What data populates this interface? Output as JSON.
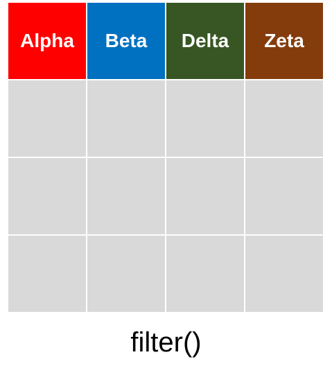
{
  "table": {
    "headers": [
      {
        "label": "Alpha",
        "color": "#ff0000"
      },
      {
        "label": "Beta",
        "color": "#0070c0"
      },
      {
        "label": "Delta",
        "color": "#375623"
      },
      {
        "label": "Zeta",
        "color": "#843c0c"
      }
    ],
    "empty_rows": 3,
    "cell_color": "#d9d9d9"
  },
  "caption": "filter()"
}
